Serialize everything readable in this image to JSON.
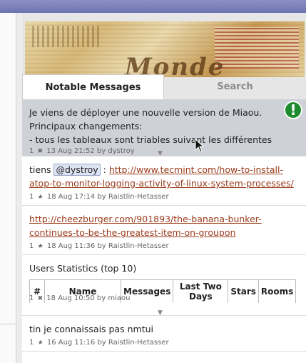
{
  "tabs": {
    "notable": "Notable Messages",
    "search": "Search"
  },
  "alert": {
    "symbol": "!",
    "color": "#1e8a2e"
  },
  "banner": {
    "word": "Monde"
  },
  "messages": [
    {
      "lines": [
        "Je viens de déployer une nouvelle version de Miaou.",
        "Principaux changements:",
        "- tous les tableaux sont triables suivant les différentes"
      ],
      "votes": "1",
      "date": "13 Aug 21:52",
      "by": "by dystroy"
    },
    {
      "prefix": "tiens",
      "mention": "@dystroy",
      "sep": ":",
      "link": "http://www.tecmint.com/how-to-install-atop-to-monitor-logging-activity-of-linux-system-processes/",
      "link_l1": "http://www.tecmint.com/how-to-install-",
      "link_l2": "atop-to-monitor-logging-activity-of-linux-system-processes/",
      "votes": "1",
      "date": "18 Aug 17:14",
      "by": "by Raistlin-Hetasser"
    },
    {
      "link_l1": "http://cheezburger.com/901893/the-banana-bunker-",
      "link_l2": "continues-to-be-the-greatest-item-on-groupon",
      "votes": "1",
      "date": "18 Aug 11:36",
      "by": "by Raistlin-Hetasser"
    },
    {
      "title": "Users Statistics (top 10)",
      "headers": [
        "#",
        "Name",
        "Messages",
        "Last Two Days",
        "Stars",
        "Rooms"
      ],
      "votes": "1",
      "date": "18 Aug 10:50",
      "by": "by miaou"
    },
    {
      "text": "tin je connaissais pas nmtui",
      "votes": "1",
      "date": "16 Aug 11:16",
      "by": "by Raistlin-Hetasser"
    }
  ],
  "star_glyph": "★",
  "pin_glyph": "✖"
}
